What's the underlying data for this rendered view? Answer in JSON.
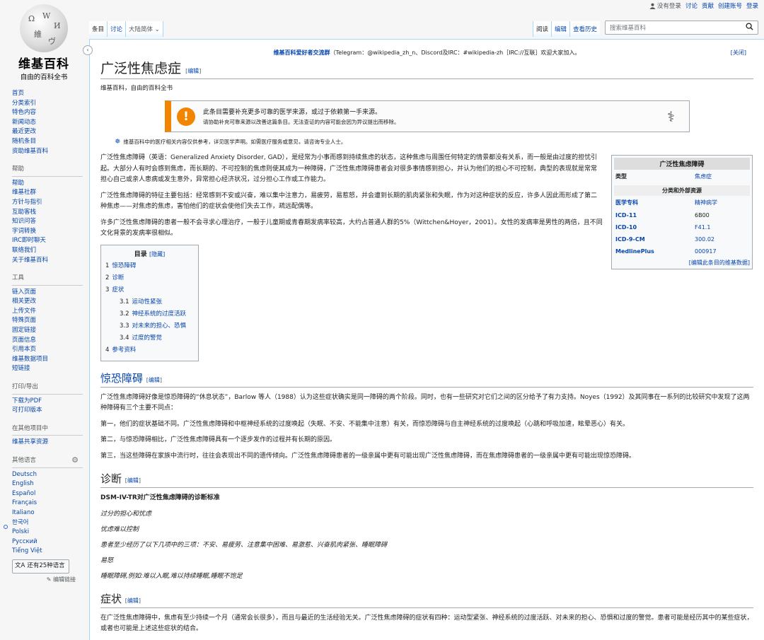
{
  "personal": {
    "not_logged_in": "没有登录",
    "talk": "讨论",
    "contrib": "贡献",
    "create": "创建账号",
    "login": "登录"
  },
  "logo": {
    "wordmark": "维基百科",
    "tagline": "自由的百科全书"
  },
  "tabs": {
    "article": "条目",
    "talk": "讨论",
    "variant": "大陆简体",
    "read": "阅读",
    "edit": "编辑",
    "history": "查看历史"
  },
  "search": {
    "placeholder": "搜索维基百科"
  },
  "sidebar": {
    "nav": [
      "首页",
      "分类索引",
      "特色内容",
      "新闻动态",
      "最近更改",
      "随机条目",
      "资助维基百科"
    ],
    "help_head": "帮助",
    "help": [
      "帮助",
      "维基社群",
      "方针与指引",
      "互助客栈",
      "知识问答",
      "字词转换",
      "IRC即时聊天",
      "联络我们",
      "关于维基百科"
    ],
    "tools_head": "工具",
    "tools": [
      "链入页面",
      "相关更改",
      "上传文件",
      "特殊页面",
      "固定链接",
      "页面信息",
      "引用本页",
      "维基数据项目",
      "短链接"
    ],
    "print_head": "打印/导出",
    "print": [
      "下载为PDF",
      "可打印版本"
    ],
    "other_head": "在其他项目中",
    "other": [
      "维基共享资源"
    ],
    "lang_head": "其他语言",
    "langs": [
      "Deutsch",
      "English",
      "Español",
      "Français",
      "Italiano",
      "한국어",
      "Polski",
      "Русский",
      "Tiếng Việt"
    ],
    "more_langs": "还有25种语言",
    "edit_links": "编辑链接"
  },
  "notice": {
    "bold": "维基百科爱好者交流群",
    "text": "（Telegram：@wikipedia_zh_n、Discord及IRC：#wikipedia-zh［IRC://互联］欢迎大家加入。",
    "close": "[关闭]"
  },
  "page": {
    "title": "广泛性焦虑症",
    "edit": "编辑",
    "tagline": "维基百科，自由的百科全书"
  },
  "ambox": {
    "l1": "此条目需要补充更多可靠的医学来源，或过于依赖第一手来源。",
    "l2": "请协助补充可靠来源以改善这篇条目。无法查证的内容可能会因为异议提出而移除。"
  },
  "medwarn": "维基百科中的医疗相关内容仅供参考，详见医学声明。如需医疗服务或意见，请咨询专业人士。",
  "infobox": {
    "title": "广泛性焦虑障碍",
    "type_k": "类型",
    "type_v": "焦虑症",
    "section": "分类和外部资源",
    "rows": [
      {
        "k": "医学专科",
        "v": "精神病学"
      },
      {
        "k": "ICD-11",
        "v": "6B00"
      },
      {
        "k": "ICD-10",
        "v": "F41.1"
      },
      {
        "k": "ICD-9-CM",
        "v": "300.02"
      },
      {
        "k": "MedlinePlus",
        "v": "000917"
      }
    ],
    "foot": "[编辑此条目的维基数据]"
  },
  "lead": [
    "广泛性焦虑障碍（英语：Generalized Anxiety Disorder, GAD），是经常为小事而感到持续焦虑的状态，这种焦虑与周围任何特定的情景都没有关系，而一般是由过度的担忧引起。大部分人有时会感到焦虑，而长期的、不可控制的焦虑则使其成为一种障碍，广泛性焦虑障碍患者会对很多事情感到担心，并认为他们的担心不可控制，典型的表现就是常常担心自己或亲人患病或发生意外，异常担心经济状况，过分担心工作或工作能力。",
    "广泛性焦虑障碍的特征主要包括：经常感到不安或兴奋，难以集中注意力，易疲劳，易惹怒，并会遭到长期的肌肉紧张和失眠，作为对这种症状的反应，许多人因此而形成了第二种焦虑——对焦虑的焦虑，害怕他们的症状会使他们失去工作，疏远配偶等。",
    "许多广泛性焦虑障碍的患者一般不会寻求心理治疗，一般于儿童期或青春期发病率较高，大约占普通人群的5%（Wittchen&Hoyer，2001）。女性的发病率是男性的两倍，且不同文化背景的发病率很相似。"
  ],
  "toc": {
    "title": "目录",
    "hide": "[隐藏]",
    "items": [
      {
        "num": "1",
        "text": "惊恐障碍"
      },
      {
        "num": "2",
        "text": "诊断"
      },
      {
        "num": "3",
        "text": "症状"
      },
      {
        "num": "3.1",
        "text": "运动性紧张"
      },
      {
        "num": "3.2",
        "text": "神经系统的过度活跃"
      },
      {
        "num": "3.3",
        "text": "对未来的担心、恐惧"
      },
      {
        "num": "3.4",
        "text": "过度的警觉"
      },
      {
        "num": "4",
        "text": "参考资料"
      }
    ]
  },
  "s1": {
    "title": "惊恐障碍",
    "paras": [
      "广泛性焦虑障碍好像是惊恐障碍的“休息状态”，Barlow 等人（1988）认为这些症状确实是同一障碍的两个阶段。同时，也有一些研究对它们之间的区分给予了有力支持。Noyes（1992）及其同事在一系列的比较研究中发现了这两种障碍有三个主要不同点：",
      "第一，他们的症状基础不同。广泛性焦虑障碍和中枢神经系统的过度唤起（失眠、不安、不能集中注意）有关，而惊恐障碍与自主神经系统的过度唤起（心跳和呼吸加速，眩晕恶心）有关。",
      "第二，与惊恐障碍相比，广泛性焦虑障碍具有一个逐步发作的过程并有长期的原因。",
      "第三，当这些障碍在家族中流行时，往往会表现出不同的遗传倾向。广泛性焦虑障碍患者的一级亲属中更有可能出现广泛性焦虑障碍，而在焦虑障碍患者的一级亲属中更有可能出现惊恐障碍。"
    ]
  },
  "s2": {
    "title": "诊断",
    "lead": "DSM-IV-TR对广泛性焦虑障碍的诊断标准",
    "items": [
      "过分的担心和忧虑",
      "忧虑难以控制",
      "患者至少经历了以下几项中的三项：不安、易疲劳、注意集中困难、易激惹、兴奋肌肉紧张、睡眠障碍",
      "易怒",
      "睡眠障碍,例如:难以入眠,难以持续睡眠,睡眠不饱足"
    ]
  },
  "s3": {
    "title": "症状",
    "para": "在广泛性焦虑障碍中，焦虑有至少持续一个月（通常会长很多），而且与最近的生活经验无关。广泛性焦虑障碍的症状有四种：运动型紧张、神经系统的过度活跃、对未来的担心、恐惧和过度的警觉。患者可能是经历其中的某些症状，或者也可能是上述这些症状的结合。"
  }
}
